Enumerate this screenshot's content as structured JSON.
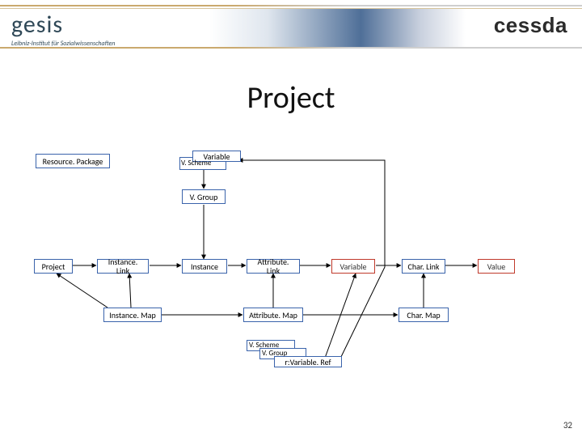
{
  "header": {
    "logo_text": "gesis",
    "logo_sub": "Leibniz-Institut für Sozialwissenschaften",
    "right_brand": "cessda"
  },
  "title": "Project",
  "boxes": {
    "resource_package": "Resource. Package",
    "variable": "Variable",
    "v_scheme": "V. Scheme",
    "v_group": "V. Group",
    "project": "Project",
    "instance_link": "Instance. Link",
    "instance": "Instance",
    "attribute_link": "Attribute. Link",
    "variable2": "Variable",
    "char_link": "Char. Link",
    "value": "Value",
    "instance_map": "Instance. Map",
    "attribute_map": "Attribute. Map",
    "char_map": "Char. Map",
    "cluster_v_scheme": "V. Scheme",
    "cluster_v_group": "V. Group",
    "cluster_variable_ref": "r:Variable. Ref"
  },
  "slide_number": "32"
}
